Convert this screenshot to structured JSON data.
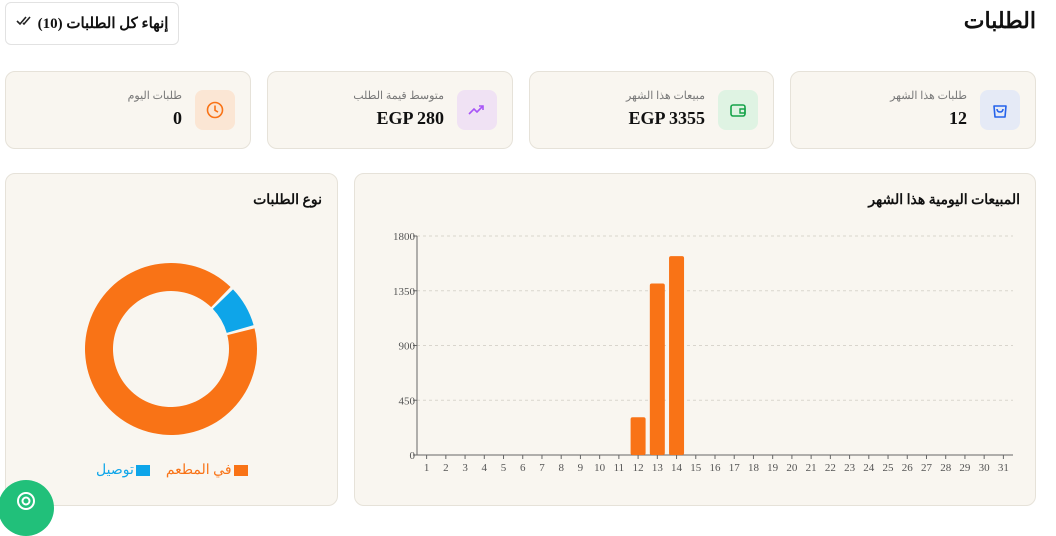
{
  "header": {
    "title": "الطلبات",
    "finish_all_label": "إنهاء كل الطلبات (10)",
    "finish_icon": "double-check-icon"
  },
  "stats": [
    {
      "key": "month_orders",
      "label": "طلبات هذا الشهر",
      "value": "12",
      "icon": "shopping-bag-icon",
      "color": "#2563eb",
      "bg": "#e5eaf6"
    },
    {
      "key": "month_sales",
      "label": "مبيعات هذا الشهر",
      "value": "EGP 3355",
      "icon": "wallet-icon",
      "color": "#16a34a",
      "bg": "#dff3e3"
    },
    {
      "key": "avg_order",
      "label": "متوسط قيمة الطلب",
      "value": "EGP 280",
      "icon": "trending-up-icon",
      "color": "#a855f7",
      "bg": "#f0e2f4"
    },
    {
      "key": "today_orders",
      "label": "طلبات اليوم",
      "value": "0",
      "icon": "clock-icon",
      "color": "#f97316",
      "bg": "#fbe6d4"
    }
  ],
  "sales_panel": {
    "title": "المبيعات اليومية هذا الشهر"
  },
  "type_panel": {
    "title": "نوع الطلبات"
  },
  "chart_data": [
    {
      "type": "bar",
      "title": "المبيعات اليومية هذا الشهر",
      "categories": [
        "1",
        "2",
        "3",
        "4",
        "5",
        "6",
        "7",
        "8",
        "9",
        "10",
        "11",
        "12",
        "13",
        "14",
        "15",
        "16",
        "17",
        "18",
        "19",
        "20",
        "21",
        "22",
        "23",
        "24",
        "25",
        "26",
        "27",
        "28",
        "29",
        "30",
        "31"
      ],
      "values": [
        0,
        0,
        0,
        0,
        0,
        0,
        0,
        0,
        0,
        0,
        0,
        310,
        1410,
        1635,
        0,
        0,
        0,
        0,
        0,
        0,
        0,
        0,
        0,
        0,
        0,
        0,
        0,
        0,
        0,
        0,
        0
      ],
      "ylim": [
        0,
        1800
      ],
      "yticks": [
        "0",
        "450",
        "900",
        "1350",
        "1800"
      ],
      "grid": true,
      "color": "#f97316"
    },
    {
      "type": "pie",
      "title": "نوع الطلبات",
      "labels": [
        "في المطعم",
        "توصيل"
      ],
      "values": [
        11,
        1
      ],
      "colors": [
        "#f97316",
        "#0ea5e9"
      ],
      "legend": "bottom"
    }
  ],
  "fab": {
    "icon": "support-icon",
    "color": "#21c07a"
  }
}
